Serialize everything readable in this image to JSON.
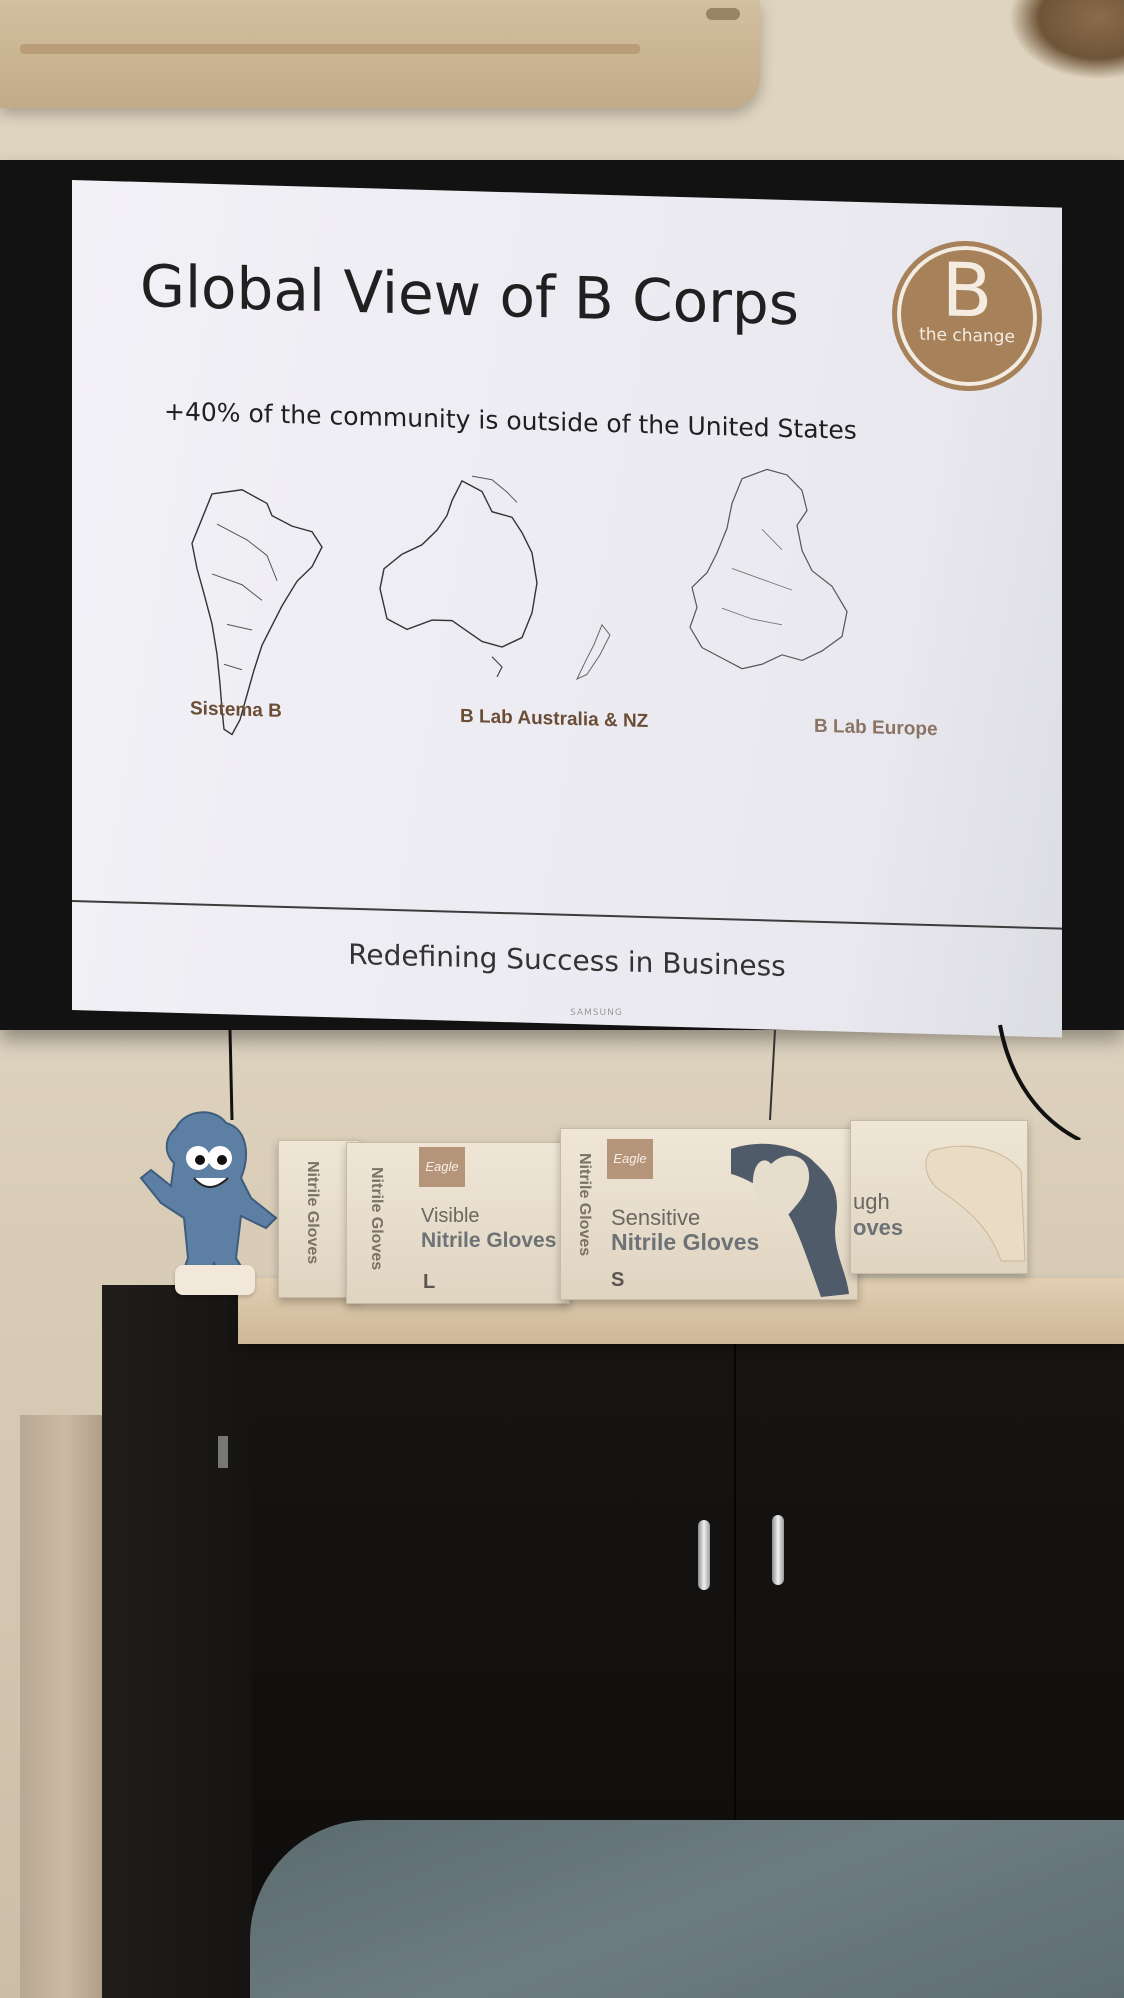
{
  "slide": {
    "title": "Global View of B Corps",
    "subtitle": "+40% of the community is outside of the United States",
    "logo_letter": "B",
    "logo_text": "the change",
    "regions": [
      {
        "label": "Sistema B"
      },
      {
        "label": "B Lab Australia & NZ"
      },
      {
        "label": "B Lab Europe"
      }
    ],
    "footer": "Redefining Success in Business"
  },
  "tv": {
    "brand": "SAMSUNG"
  },
  "glove_boxes": [
    {
      "line1": "Visible",
      "line2": "Nitrile Gloves",
      "size": "L",
      "brand": "Eagle"
    },
    {
      "line1": "Visible",
      "line2": "Nitrile Gloves",
      "size": "L",
      "brand": "Eagle"
    },
    {
      "line1": "Sensitive",
      "line2": "Nitrile Gloves",
      "size": "S",
      "brand": "Eagle"
    },
    {
      "line1": "ugh",
      "line2": "oves",
      "size": "",
      "brand": ""
    }
  ],
  "side_labels": [
    "Nitrile Gloves",
    "Nitrile Gloves",
    "Nitrile Gloves"
  ],
  "colors": {
    "wall": "#e4dac8",
    "slide_background": "#efeef4",
    "logo_brown": "#a7815a",
    "region_label": "#6b4d36",
    "cabinet": "#141210",
    "counter": "#d9c4a5"
  }
}
